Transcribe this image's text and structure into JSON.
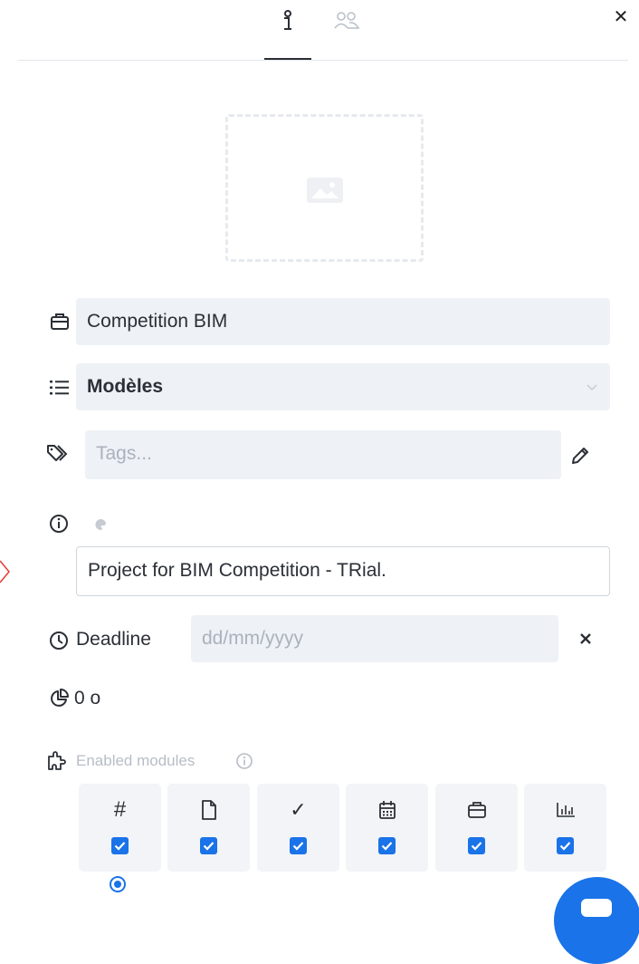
{
  "header": {
    "tabs": [
      {
        "icon": "info-icon",
        "active": true
      },
      {
        "icon": "users-icon",
        "active": false
      }
    ],
    "close_icon": "close-icon"
  },
  "image_placeholder": {
    "icon": "image-icon"
  },
  "project": {
    "name": "Competition BIM",
    "category": "Modèles",
    "tags_placeholder": "Tags...",
    "description": "Project for BIM Competition - TRial.",
    "deadline_label": "Deadline",
    "deadline_placeholder": "dd/mm/yyyy",
    "storage": "0 o"
  },
  "modules": {
    "label": "Enabled modules",
    "items": [
      {
        "icon": "hash-icon",
        "glyph": "#",
        "checked": true
      },
      {
        "icon": "document-icon",
        "checked": true
      },
      {
        "icon": "checkmark-icon",
        "glyph": "✓",
        "checked": true
      },
      {
        "icon": "calendar-icon",
        "checked": true
      },
      {
        "icon": "briefcase-icon",
        "checked": true
      },
      {
        "icon": "bar-chart-icon",
        "checked": true
      }
    ]
  },
  "colors": {
    "accent": "#1a73e8",
    "field_bg": "#eef1f5",
    "text": "#2b2f36",
    "muted": "#b7bdc6"
  }
}
